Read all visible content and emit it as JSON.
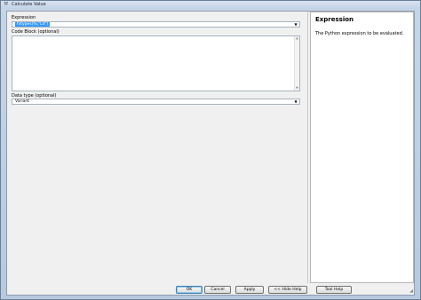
{
  "window": {
    "title": "Calculate Value",
    "icon": "hammer-icon"
  },
  "form": {
    "expression": {
      "label": "Expression",
      "value": "fvtypes(%,\"Ld\")"
    },
    "code_block": {
      "label": "Code Block (optional)",
      "value": ""
    },
    "data_type": {
      "label": "Data type (optional)",
      "value": "Variant"
    }
  },
  "help": {
    "title": "Expression",
    "text": "The Python expression to be evaluated."
  },
  "buttons": {
    "ok": "OK",
    "cancel": "Cancel",
    "apply": "Apply",
    "hide_help": "<< Hide Help",
    "tool_help": "Tool Help"
  }
}
